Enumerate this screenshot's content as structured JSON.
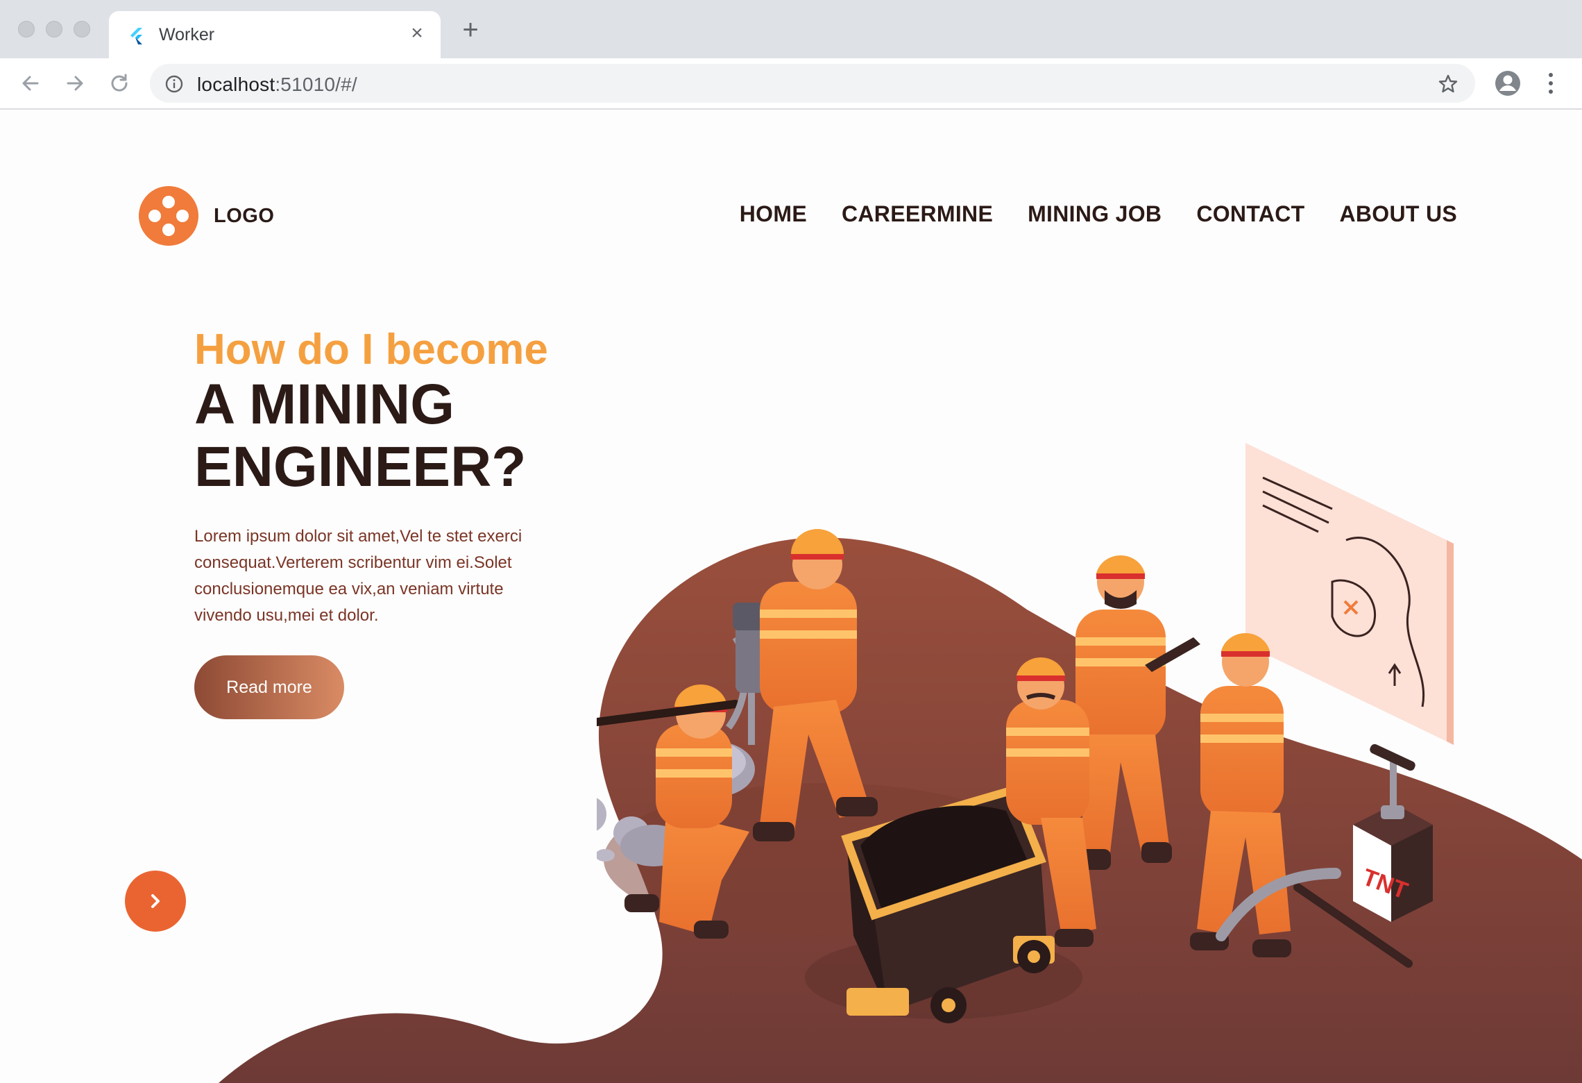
{
  "browser": {
    "tab_title": "Worker",
    "tab_close": "×",
    "new_tab": "+",
    "url_host": "localhost",
    "url_rest": ":51010/#/"
  },
  "logo": {
    "text": "LOGO"
  },
  "nav": {
    "items": [
      {
        "label": "HOME"
      },
      {
        "label": "CAREERMINE"
      },
      {
        "label": "MINING JOB"
      },
      {
        "label": "CONTACT"
      },
      {
        "label": "ABOUT US"
      }
    ]
  },
  "hero": {
    "subtitle": "How do I become",
    "title_line1": "A MINING",
    "title_line2": "ENGINEER?",
    "text": "Lorem ipsum dolor sit amet,Vel te stet exerci consequat.Verterem scribentur vim ei.Solet conclusionemque ea vix,an veniam virtute vivendo usu,mei et dolor.",
    "button_label": "Read more"
  },
  "illustration": {
    "tnt_label": "TNT"
  },
  "colors": {
    "accent_orange": "#f07b3a",
    "subtitle_orange": "#f5a040",
    "dark_brown": "#2b1a16",
    "text_brown": "#7a3526",
    "blob_brown": "#8a4638"
  },
  "icons": [
    "back-icon",
    "forward-icon",
    "reload-icon",
    "info-icon",
    "star-icon",
    "profile-icon",
    "menu-icon",
    "chevron-right-icon",
    "flutter-icon"
  ]
}
